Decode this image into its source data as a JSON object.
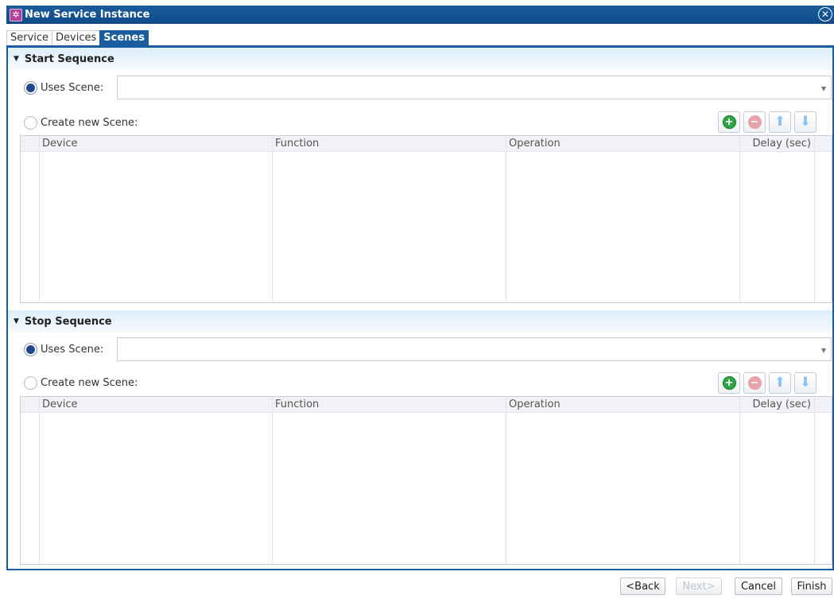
{
  "window": {
    "title": "New Service Instance",
    "app_icon": "service-icon",
    "close_icon": "close-icon"
  },
  "tabs": [
    {
      "label": "Service",
      "active": false
    },
    {
      "label": "Devices",
      "active": false
    },
    {
      "label": "Scenes",
      "active": true
    }
  ],
  "sections": [
    {
      "title": "Start Sequence",
      "uses_scene_label": "Uses Scene:",
      "uses_scene_selected": true,
      "scene_value": "",
      "create_scene_label": "Create new Scene:",
      "columns": [
        "Device",
        "Function",
        "Operation",
        "Delay (sec)"
      ]
    },
    {
      "title": "Stop Sequence",
      "uses_scene_label": "Uses Scene:",
      "uses_scene_selected": true,
      "scene_value": "",
      "create_scene_label": "Create new Scene:",
      "columns": [
        "Device",
        "Function",
        "Operation",
        "Delay (sec)"
      ]
    }
  ],
  "footer": {
    "back_label": "<Back",
    "next_label": "Next>",
    "cancel_label": "Cancel",
    "finish_label": "Finish"
  },
  "colors": {
    "titlebar": "#1a5d9e",
    "add_button": "#2ea444",
    "remove_button": "#e8a3a8",
    "move_arrows": "#8fc3ee"
  }
}
